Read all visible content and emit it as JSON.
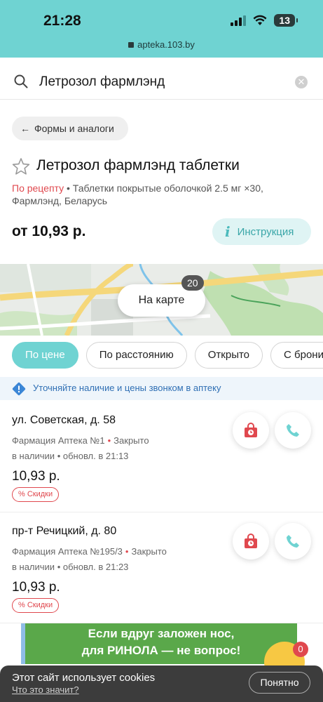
{
  "status": {
    "time": "21:28",
    "battery": "13",
    "url": "apteka.103.by"
  },
  "search": {
    "value": "Летрозол фармлэнд",
    "clear_icon": "close-icon"
  },
  "back_chip": {
    "label": "Формы и аналоги"
  },
  "product": {
    "title": "Летрозол фармлэнд таблетки",
    "rx": "По рецепту",
    "description": "Таблетки покрытые оболочкой 2.5 мг ×30, Фармлэнд, Беларусь",
    "price_from": "от 10,93 р.",
    "instruction_label": "Инструкция"
  },
  "map": {
    "button_label": "На карте",
    "count": "20"
  },
  "filters": [
    "По цене",
    "По расстоянию",
    "Открыто",
    "С бронир"
  ],
  "notice": "Уточняйте наличие и цены звонком в аптеку",
  "pharmacies": [
    {
      "address": "ул. Советская, д. 58",
      "name": "Фармация Аптека №1",
      "status": "Закрыто",
      "stock": "в наличии",
      "updated": "обновл. в 21:13",
      "price": "10,93 р.",
      "discount": "Скидки"
    },
    {
      "address": "пр-т Речицкий, д. 80",
      "name": "Фармация Аптека №195/3",
      "status": "Закрыто",
      "stock": "в наличии",
      "updated": "обновл. в 21:23",
      "price": "10,93 р.",
      "discount": "Скидки"
    }
  ],
  "ad": {
    "line1": "Если вдруг заложен нос,",
    "line2": "для РИНОЛА — не вопрос!"
  },
  "favorites_count": "0",
  "cookie": {
    "title": "Этот сайт использует cookies",
    "link": "Что это значит?",
    "button": "Понятно"
  },
  "colors": {
    "accent": "#6fd3d2",
    "danger": "#e0484e",
    "info": "#2f6fb4"
  }
}
